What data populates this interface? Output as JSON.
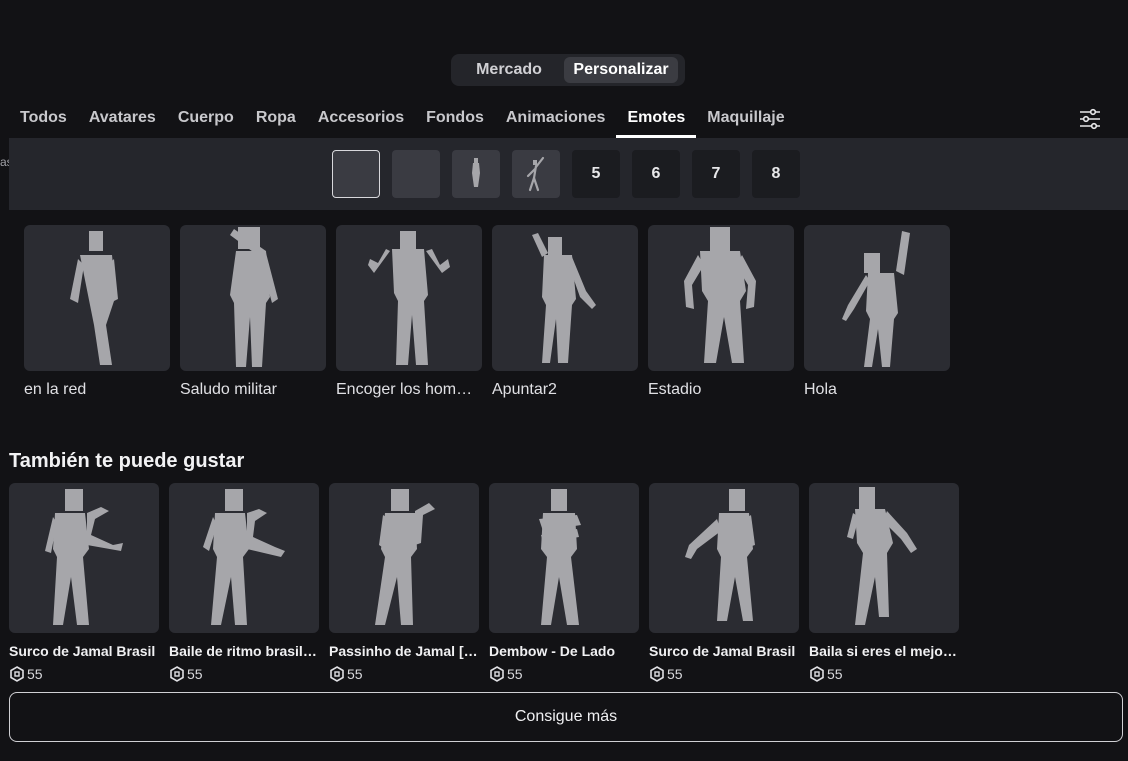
{
  "toggle": {
    "market": "Mercado",
    "customize": "Personalizar",
    "active": "customize"
  },
  "tabs": [
    {
      "label": "Todos"
    },
    {
      "label": "Avatares"
    },
    {
      "label": "Cuerpo"
    },
    {
      "label": "Ropa"
    },
    {
      "label": "Accesorios"
    },
    {
      "label": "Fondos"
    },
    {
      "label": "Animaciones"
    },
    {
      "label": "Emotes",
      "active": true
    },
    {
      "label": "Maquillaje"
    }
  ],
  "edge_text": "as",
  "slots": [
    "",
    "",
    "",
    "",
    "5",
    "6",
    "7",
    "8"
  ],
  "equipped": [
    {
      "name": "en la red"
    },
    {
      "name": "Saludo militar"
    },
    {
      "name": "Encoger los hom…"
    },
    {
      "name": "Apuntar2"
    },
    {
      "name": "Estadio"
    },
    {
      "name": "Hola"
    }
  ],
  "recommended_title": "También te puede gustar",
  "recommended": [
    {
      "name": "Surco de Jamal Brasil",
      "price": "55"
    },
    {
      "name": "Baile de ritmo brasil…",
      "price": "55"
    },
    {
      "name": "Passinho de Jamal […",
      "price": "55"
    },
    {
      "name": "Dembow - De Lado",
      "price": "55"
    },
    {
      "name": "Surco de Jamal Brasil",
      "price": "55"
    },
    {
      "name": "Baila si eres el mejo…",
      "price": "55"
    }
  ],
  "more_button": "Consigue más",
  "colors": {
    "background": "#121215",
    "card": "#2b2c32",
    "figure": "#a6a6aa",
    "slotbar": "#25262c"
  },
  "icons": {
    "filter": "sliders-icon",
    "currency": "robux-icon"
  }
}
